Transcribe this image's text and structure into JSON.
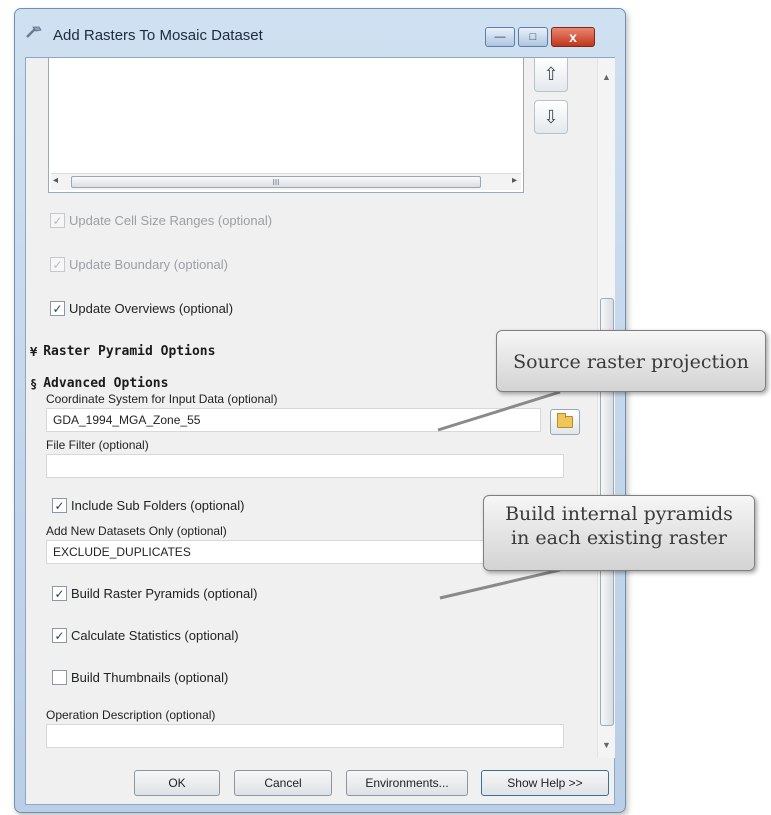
{
  "window": {
    "title": "Add Rasters To Mosaic Dataset",
    "controls": {
      "minimize": "—",
      "maximize": "□",
      "close": "x"
    }
  },
  "raster_list": {
    "move_up_icon": "arrow-up-icon",
    "move_down_icon": "arrow-down-icon",
    "move_up_glyph": "⇧",
    "move_down_glyph": "⇩",
    "hscroll_left": "◂",
    "hscroll_right": "▸",
    "hscroll_grip": "III"
  },
  "options": {
    "update_cell_size": {
      "label": "Update Cell Size Ranges (optional)",
      "checked": true,
      "enabled": false
    },
    "update_boundary": {
      "label": "Update Boundary (optional)",
      "checked": true,
      "enabled": false
    },
    "update_overviews": {
      "label": "Update Overviews (optional)",
      "checked": true,
      "enabled": true
    }
  },
  "sections": {
    "raster_pyramid": {
      "label": "Raster Pyramid Options",
      "expanded": false,
      "chevron": "¥"
    },
    "advanced": {
      "label": "Advanced Options",
      "expanded": true,
      "chevron": "§"
    }
  },
  "advanced": {
    "coord_label": "Coordinate System for Input Data (optional)",
    "coord_value": "GDA_1994_MGA_Zone_55",
    "file_filter_label": "File Filter (optional)",
    "file_filter_value": "",
    "include_sub_folders": {
      "label": "Include Sub Folders (optional)",
      "checked": true
    },
    "add_new_label": "Add New Datasets Only (optional)",
    "add_new_value": "EXCLUDE_DUPLICATES",
    "build_raster_pyramids": {
      "label": "Build Raster Pyramids (optional)",
      "checked": true
    },
    "calculate_statistics": {
      "label": "Calculate Statistics (optional)",
      "checked": true
    },
    "build_thumbnails": {
      "label": "Build Thumbnails (optional)",
      "checked": false
    },
    "operation_description_label": "Operation Description (optional)",
    "operation_description_value": ""
  },
  "check_glyph": "✓",
  "scrollbar": {
    "up": "▲",
    "down": "▼"
  },
  "buttons": {
    "ok": "OK",
    "cancel": "Cancel",
    "environments": "Environments...",
    "show_help": "Show Help >>"
  },
  "callouts": {
    "projection": "Source raster projection",
    "pyramids_line1": "Build internal pyramids",
    "pyramids_line2": "in each existing raster"
  }
}
